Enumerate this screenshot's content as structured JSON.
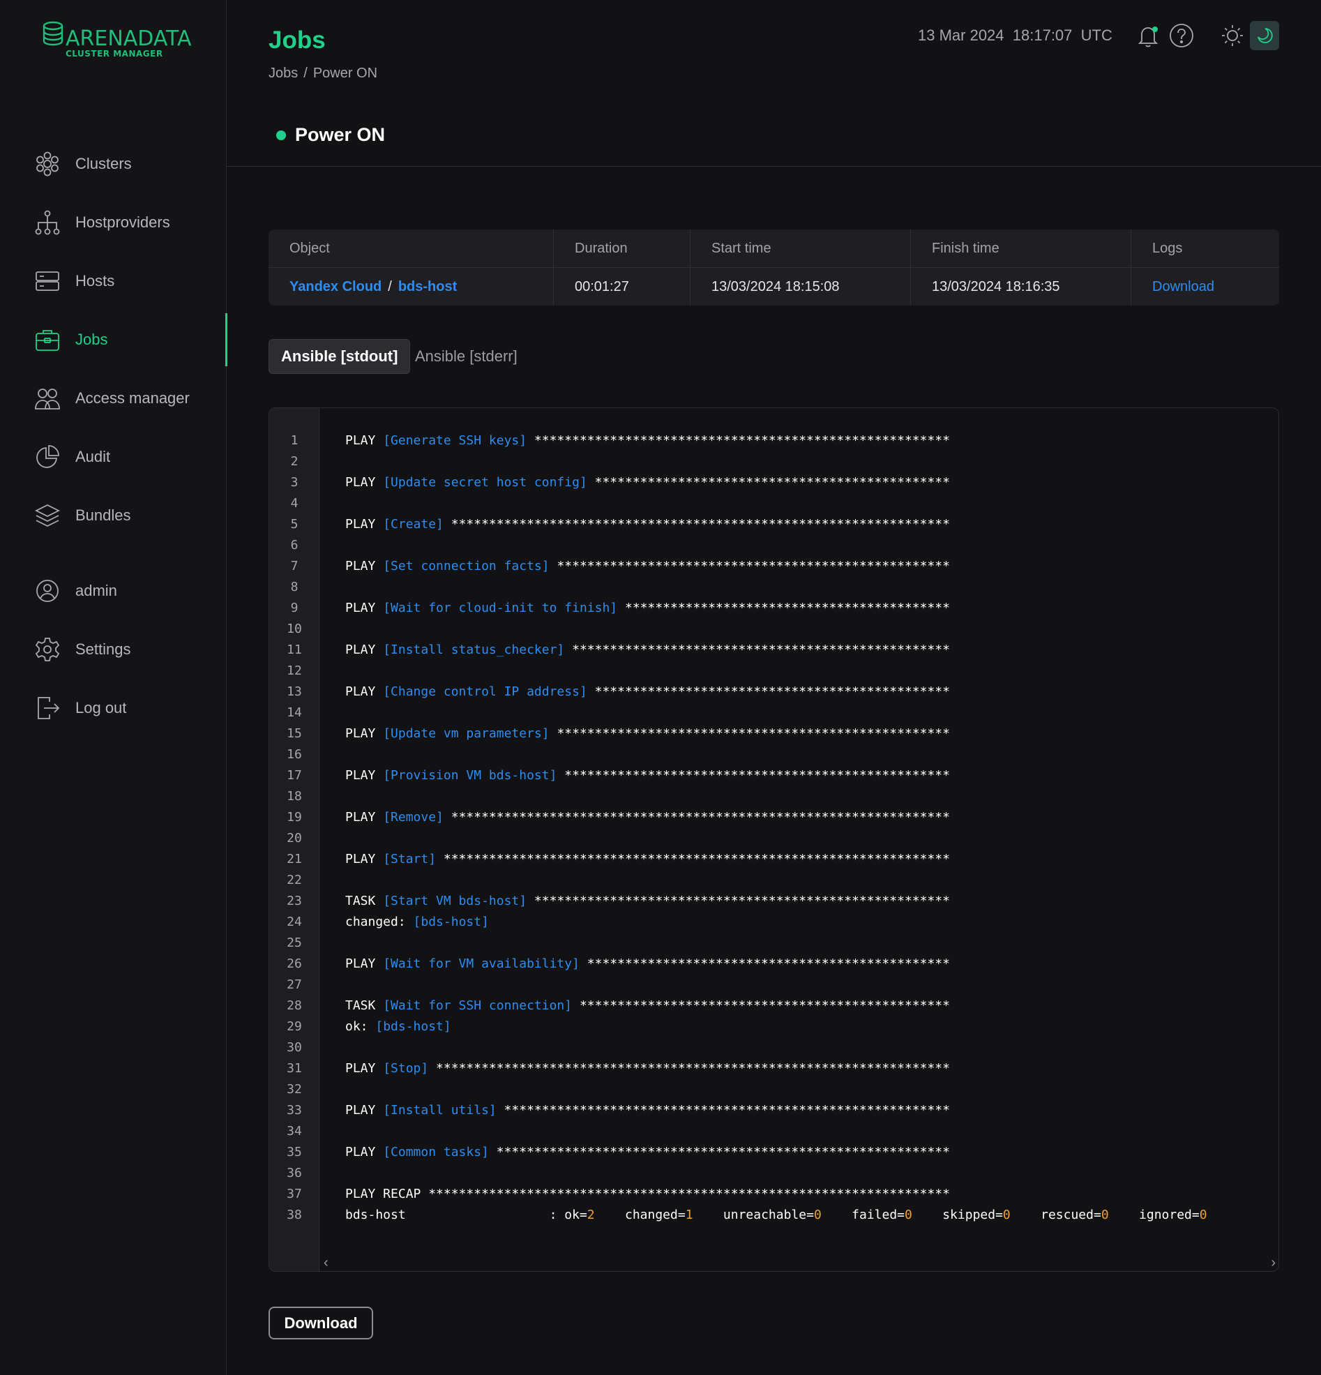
{
  "brand": {
    "name": "ARENADATA",
    "sub": "CLUSTER MANAGER",
    "accent": "#1fd18a",
    "link": "#2d8df0"
  },
  "sidebar": {
    "items": [
      {
        "label": "Clusters",
        "icon": "clusters-icon"
      },
      {
        "label": "Hostproviders",
        "icon": "hierarchy-icon"
      },
      {
        "label": "Hosts",
        "icon": "server-icon"
      },
      {
        "label": "Jobs",
        "icon": "briefcase-icon",
        "active": true
      },
      {
        "label": "Access manager",
        "icon": "users-icon"
      },
      {
        "label": "Audit",
        "icon": "pie-chart-icon"
      },
      {
        "label": "Bundles",
        "icon": "layers-icon"
      },
      {
        "label": "admin",
        "icon": "user-circle-icon"
      },
      {
        "label": "Settings",
        "icon": "gear-icon"
      },
      {
        "label": "Log out",
        "icon": "logout-icon"
      }
    ]
  },
  "header": {
    "title": "Jobs",
    "breadcrumb": [
      "Jobs",
      "/",
      "Power ON"
    ],
    "date": "13 Mar 2024",
    "time": "18:17:07",
    "tz": "UTC",
    "job_name": "Power ON",
    "status": "success"
  },
  "table": {
    "headers": [
      "Object",
      "Duration",
      "Start time",
      "Finish time",
      "Logs"
    ],
    "row": {
      "object_parent": "Yandex Cloud",
      "object_sep": "/",
      "object_child": "bds-host",
      "duration": "00:01:27",
      "start": "13/03/2024 18:15:08",
      "finish": "13/03/2024 18:16:35",
      "logs": "Download"
    }
  },
  "tabs": [
    "Ansible [stdout]",
    "Ansible [stderr]"
  ],
  "log": {
    "lines": [
      {
        "n": "1",
        "kw": "PLAY ",
        "br": "[Generate SSH keys]",
        "rest": " *******************************************************"
      },
      {
        "n": "2"
      },
      {
        "n": "3",
        "kw": "PLAY ",
        "br": "[Update secret host config]",
        "rest": " ***********************************************"
      },
      {
        "n": "4"
      },
      {
        "n": "5",
        "kw": "PLAY ",
        "br": "[Create]",
        "rest": " ******************************************************************"
      },
      {
        "n": "6"
      },
      {
        "n": "7",
        "kw": "PLAY ",
        "br": "[Set connection facts]",
        "rest": " ****************************************************"
      },
      {
        "n": "8"
      },
      {
        "n": "9",
        "kw": "PLAY ",
        "br": "[Wait for cloud-init to finish]",
        "rest": " *******************************************"
      },
      {
        "n": "10"
      },
      {
        "n": "11",
        "kw": "PLAY ",
        "br": "[Install status_checker]",
        "rest": " **************************************************"
      },
      {
        "n": "12"
      },
      {
        "n": "13",
        "kw": "PLAY ",
        "br": "[Change control IP address]",
        "rest": " ***********************************************"
      },
      {
        "n": "14"
      },
      {
        "n": "15",
        "kw": "PLAY ",
        "br": "[Update vm parameters]",
        "rest": " ****************************************************"
      },
      {
        "n": "16"
      },
      {
        "n": "17",
        "kw": "PLAY ",
        "br": "[Provision VM bds-host]",
        "rest": " ***************************************************"
      },
      {
        "n": "18"
      },
      {
        "n": "19",
        "kw": "PLAY ",
        "br": "[Remove]",
        "rest": " ******************************************************************"
      },
      {
        "n": "20"
      },
      {
        "n": "21",
        "kw": "PLAY ",
        "br": "[Start]",
        "rest": " *******************************************************************"
      },
      {
        "n": "22"
      },
      {
        "n": "23",
        "kw": "TASK ",
        "br": "[Start VM bds-host]",
        "rest": " *******************************************************"
      },
      {
        "n": "24",
        "kw": "changed: ",
        "br": "[bds-host]",
        "rest": ""
      },
      {
        "n": "25"
      },
      {
        "n": "26",
        "kw": "PLAY ",
        "br": "[Wait for VM availability]",
        "rest": " ************************************************"
      },
      {
        "n": "27"
      },
      {
        "n": "28",
        "kw": "TASK ",
        "br": "[Wait for SSH connection]",
        "rest": " *************************************************"
      },
      {
        "n": "29",
        "kw": "ok: ",
        "br": "[bds-host]",
        "rest": ""
      },
      {
        "n": "30"
      },
      {
        "n": "31",
        "kw": "PLAY ",
        "br": "[Stop]",
        "rest": " ********************************************************************"
      },
      {
        "n": "32"
      },
      {
        "n": "33",
        "kw": "PLAY ",
        "br": "[Install utils]",
        "rest": " ***********************************************************"
      },
      {
        "n": "34"
      },
      {
        "n": "35",
        "kw": "PLAY ",
        "br": "[Common tasks]",
        "rest": " ************************************************************"
      },
      {
        "n": "36"
      },
      {
        "n": "37",
        "kw": "PLAY RECAP ",
        "br": "",
        "rest": "*********************************************************************"
      },
      {
        "n": "38",
        "recap": true
      }
    ],
    "recap": {
      "host": "bds-host",
      "pairs": [
        {
          "k": "ok=",
          "v": "2",
          "pad": "    "
        },
        {
          "k": "changed=",
          "v": "1",
          "pad": "    "
        },
        {
          "k": "unreachable=",
          "v": "0",
          "pad": "    "
        },
        {
          "k": "failed=",
          "v": "0",
          "pad": "    "
        },
        {
          "k": "skipped=",
          "v": "0",
          "pad": "    "
        },
        {
          "k": "rescued=",
          "v": "0",
          "pad": "    "
        },
        {
          "k": "ignored=",
          "v": "0",
          "pad": ""
        }
      ]
    }
  },
  "footer": {
    "download": "Download"
  }
}
